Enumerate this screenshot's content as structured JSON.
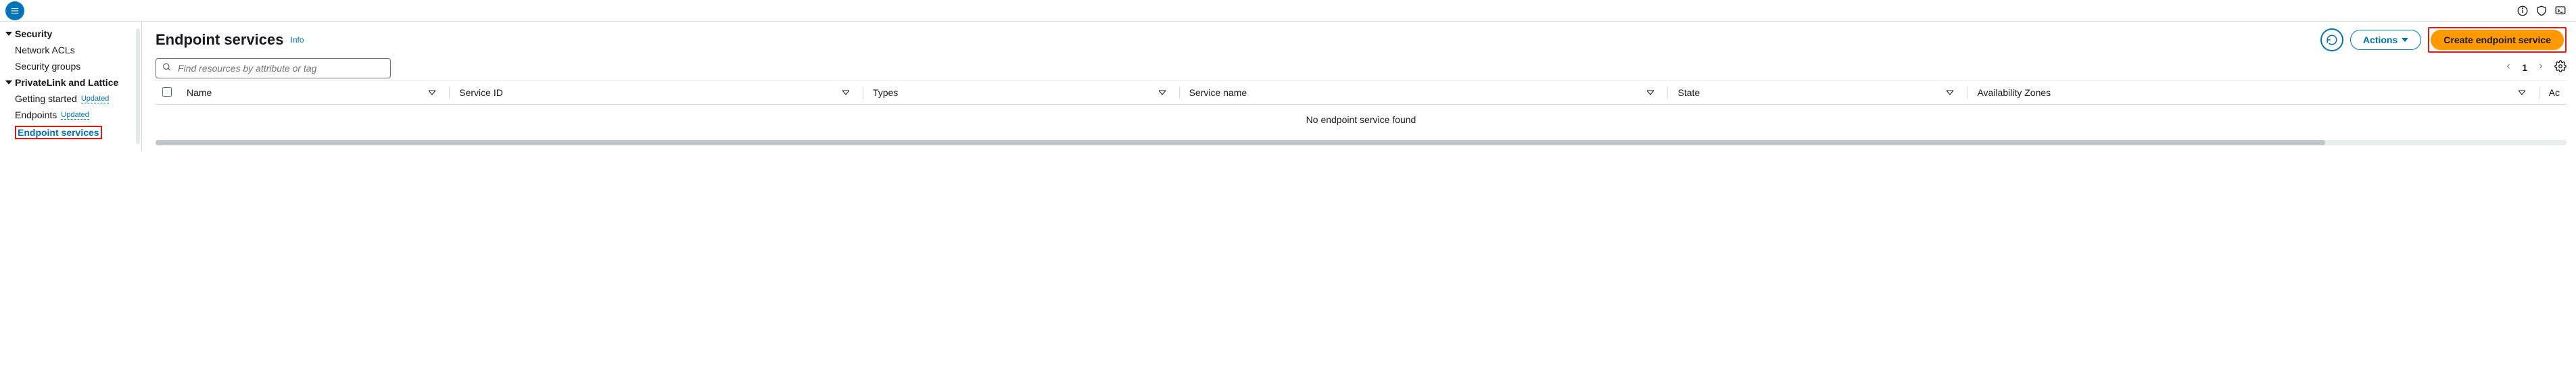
{
  "topbar": {},
  "sidebar": {
    "groups": [
      {
        "title": "Security",
        "items": [
          {
            "label": "Network ACLs",
            "selected": false
          },
          {
            "label": "Security groups",
            "selected": false
          }
        ]
      },
      {
        "title": "PrivateLink and Lattice",
        "items": [
          {
            "label": "Getting started",
            "badge": "Updated",
            "selected": false
          },
          {
            "label": "Endpoints",
            "badge": "Updated",
            "selected": false
          },
          {
            "label": "Endpoint services",
            "selected": true,
            "highlighted": true
          }
        ]
      }
    ]
  },
  "header": {
    "title": "Endpoint services",
    "info_label": "Info",
    "refresh_aria": "Refresh",
    "actions_label": "Actions",
    "create_label": "Create endpoint service"
  },
  "search": {
    "placeholder": "Find resources by attribute or tag"
  },
  "pager": {
    "page": "1"
  },
  "table": {
    "columns": [
      "Name",
      "Service ID",
      "Types",
      "Service name",
      "State",
      "Availability Zones",
      "Ac"
    ],
    "empty_message": "No endpoint service found"
  }
}
